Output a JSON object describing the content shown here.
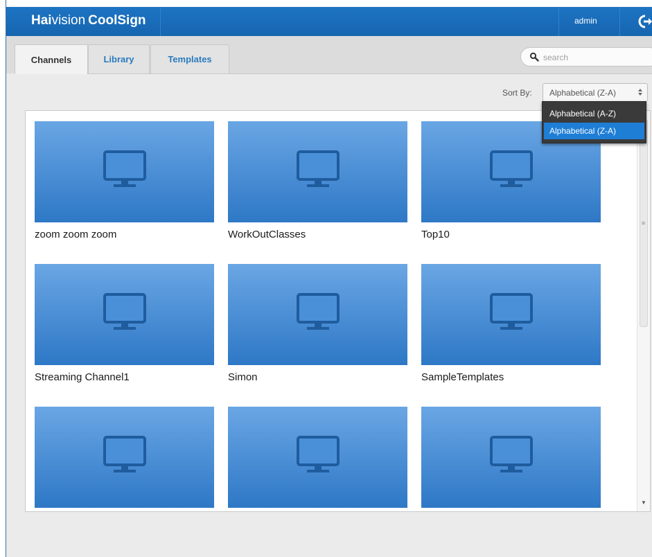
{
  "header": {
    "brand_hai": "Hai",
    "brand_vision": "vision",
    "brand_coolsign": "CoolSign",
    "user": "admin"
  },
  "tabs": [
    {
      "label": "Channels",
      "active": true
    },
    {
      "label": "Library",
      "active": false
    },
    {
      "label": "Templates",
      "active": false
    }
  ],
  "search": {
    "placeholder": "search"
  },
  "sort": {
    "label": "Sort By:",
    "selected": "Alphabetical (Z-A)",
    "options": [
      "Alphabetical (A-Z)",
      "Alphabetical (Z-A)"
    ],
    "highlighted_option": "Alphabetical (Z-A)"
  },
  "channels": [
    {
      "name": "zoom zoom zoom"
    },
    {
      "name": "WorkOutClasses"
    },
    {
      "name": "Top10"
    },
    {
      "name": "Streaming Channel1"
    },
    {
      "name": "Simon"
    },
    {
      "name": "SampleTemplates"
    },
    {
      "name": ""
    },
    {
      "name": ""
    },
    {
      "name": ""
    }
  ],
  "colors": {
    "header_blue": "#1d74c3",
    "tile_blue": "#4a90d9",
    "accent": "#1e7ed6"
  }
}
